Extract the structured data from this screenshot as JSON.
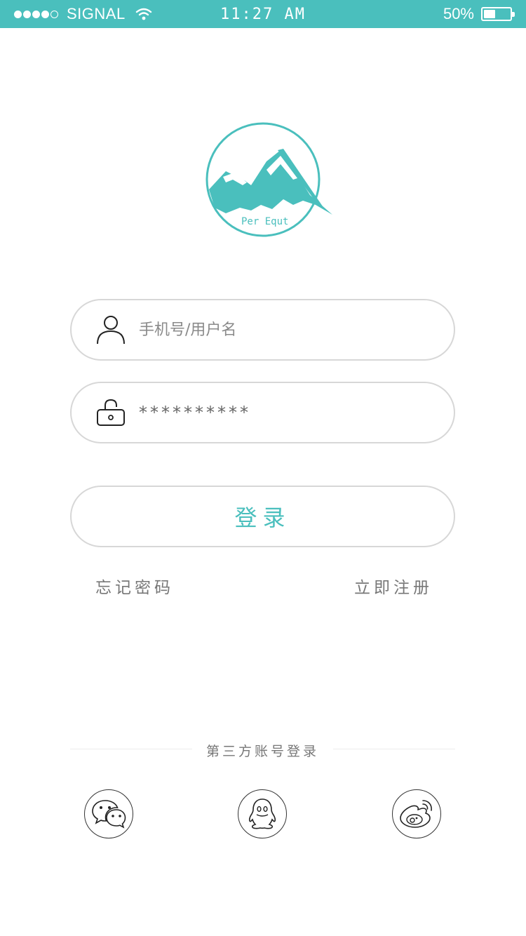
{
  "status_bar": {
    "carrier": "SIGNAL",
    "time": "11:27 AM",
    "battery_text": "50%",
    "battery_level": 0.5
  },
  "logo": {
    "text": "Per Equt",
    "color": "#4ABFBD"
  },
  "form": {
    "username_placeholder": "手机号/用户名",
    "password_value": "**********",
    "login_label": "登录"
  },
  "links": {
    "forgot": "忘记密码",
    "register": "立即注册"
  },
  "third_party": {
    "label": "第三方账号登录",
    "providers": [
      "wechat-icon",
      "qq-icon",
      "weibo-icon"
    ]
  },
  "colors": {
    "accent": "#4ABFBD",
    "border": "#d7d7d7"
  }
}
